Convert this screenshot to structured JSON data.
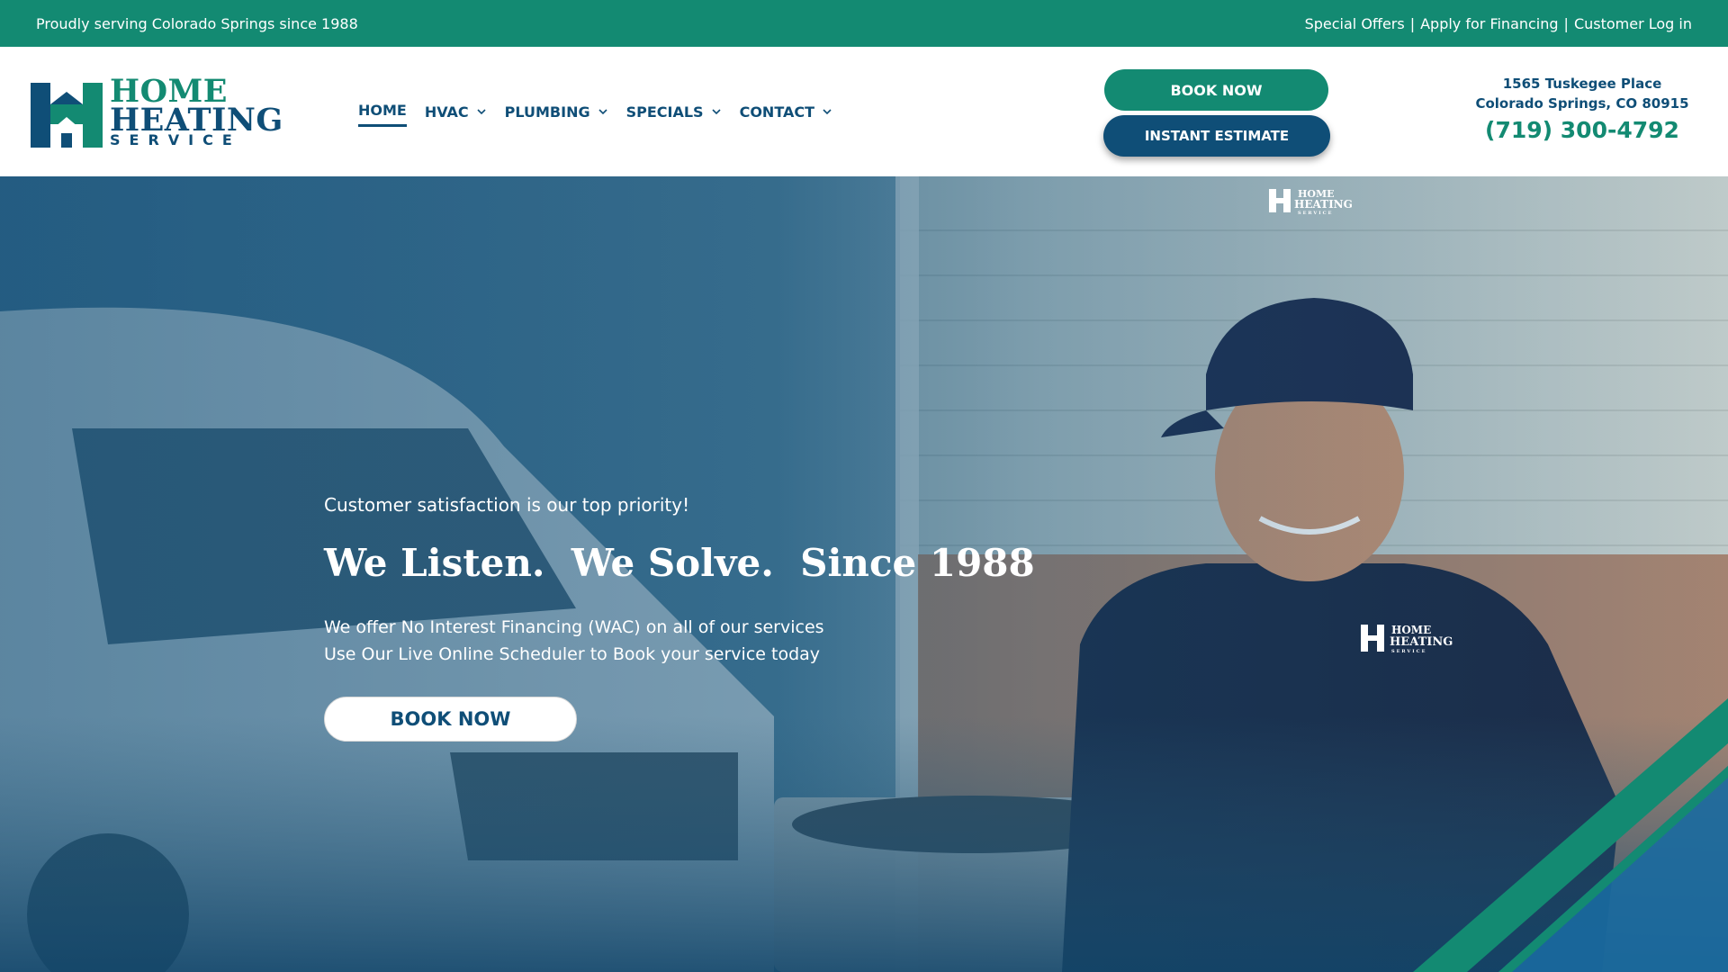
{
  "topbar": {
    "tagline": "Proudly serving Colorado Springs since 1988",
    "links": [
      {
        "label": "Special Offers"
      },
      {
        "label": "Apply for Financing"
      },
      {
        "label": "Customer Log in"
      }
    ],
    "separator": "|"
  },
  "logo": {
    "line1": "HOME",
    "line2": "HEATING",
    "line3": "SERVICE"
  },
  "nav": {
    "items": [
      {
        "label": "HOME",
        "active": true,
        "has_dropdown": false
      },
      {
        "label": "HVAC",
        "active": false,
        "has_dropdown": true
      },
      {
        "label": "PLUMBING",
        "active": false,
        "has_dropdown": true
      },
      {
        "label": "SPECIALS",
        "active": false,
        "has_dropdown": true
      },
      {
        "label": "CONTACT",
        "active": false,
        "has_dropdown": true
      }
    ]
  },
  "header": {
    "book_now_label": "BOOK NOW",
    "estimate_label": "INSTANT ESTIMATE",
    "address_line1": "1565 Tuskegee Place",
    "address_line2": "Colorado Springs, CO 80915",
    "phone": "(719) 300-4792"
  },
  "hero": {
    "tagline": "Customer satisfaction is our top priority!",
    "headline": "We Listen.  We Solve.  Since 1988",
    "line1": "We offer No Interest Financing (WAC) on all of our services",
    "line2": "Use Our Live Online Scheduler to Book your service today",
    "book_now_label": "BOOK NOW"
  },
  "photo_branding": {
    "cap_logo_line1": "HOME",
    "cap_logo_line2": "HEATING",
    "cap_logo_line3": "SERVICE",
    "shirt_logo_line1": "HOME",
    "shirt_logo_line2": "HEATING",
    "shirt_logo_line3": "SERVICE"
  },
  "colors": {
    "brand_green": "#138a72",
    "brand_blue": "#0f4e77",
    "white": "#ffffff"
  }
}
